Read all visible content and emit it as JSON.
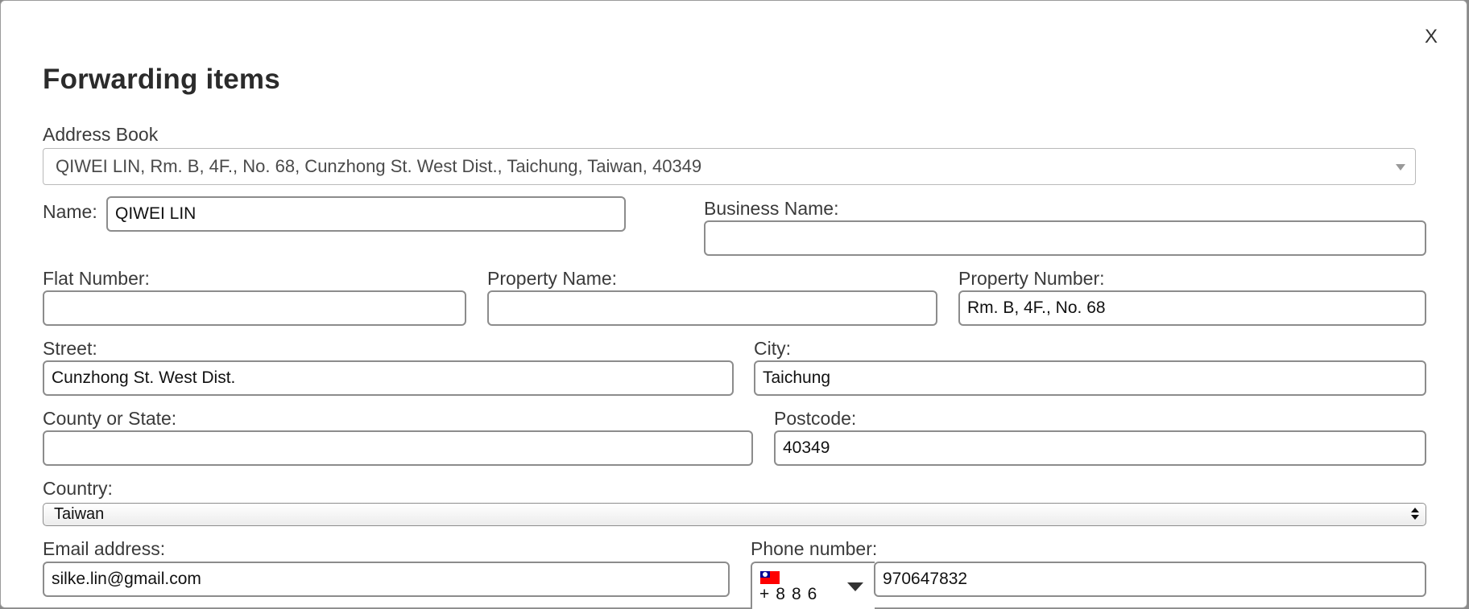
{
  "modal": {
    "close_label": "X",
    "title": "Forwarding items"
  },
  "address_book": {
    "label": "Address Book",
    "selected": "QIWEI LIN, Rm. B, 4F., No. 68, Cunzhong St. West Dist., Taichung, Taiwan, 40349"
  },
  "fields": {
    "name": {
      "label": "Name:",
      "value": "QIWEI LIN"
    },
    "business_name": {
      "label": "Business Name:",
      "value": ""
    },
    "flat_number": {
      "label": "Flat Number:",
      "value": ""
    },
    "property_name": {
      "label": "Property Name:",
      "value": ""
    },
    "property_number": {
      "label": "Property Number:",
      "value": "Rm. B, 4F., No. 68"
    },
    "street": {
      "label": "Street:",
      "value": "Cunzhong St. West Dist."
    },
    "city": {
      "label": "City:",
      "value": "Taichung"
    },
    "county_state": {
      "label": "County or State:",
      "value": ""
    },
    "postcode": {
      "label": "Postcode:",
      "value": "40349"
    },
    "country": {
      "label": "Country:",
      "selected": "Taiwan"
    },
    "email": {
      "label": "Email address:",
      "value": "silke.lin@gmail.com"
    },
    "phone": {
      "label": "Phone number:",
      "dial_code": "+886",
      "value": "970647832",
      "flag_icon": "taiwan-flag-icon"
    }
  },
  "colors": {
    "border": "#8c8c8c",
    "text": "#2b2b2b"
  }
}
